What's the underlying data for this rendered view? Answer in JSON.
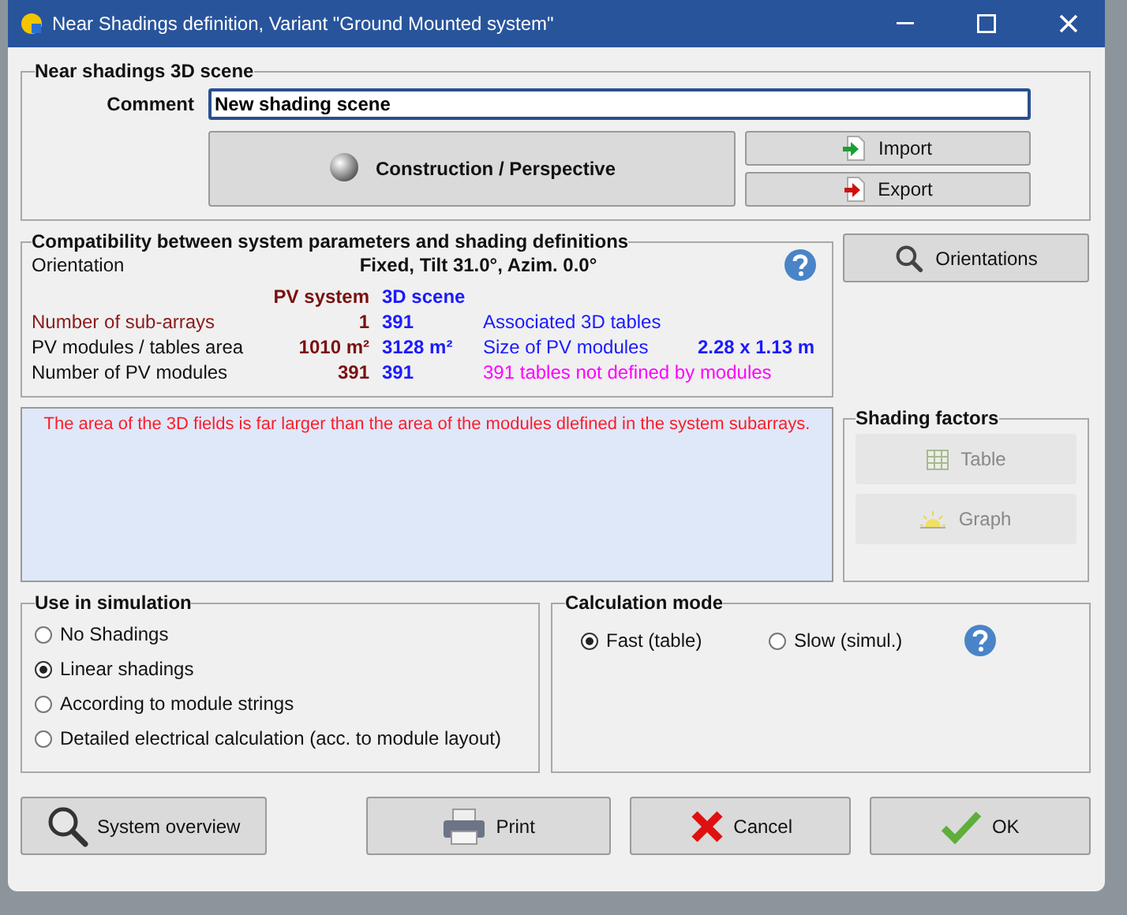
{
  "window": {
    "title": "Near Shadings definition, Variant \"Ground Mounted system\""
  },
  "scene": {
    "title": "Near shadings 3D scene",
    "comment_label": "Comment",
    "comment_value": "New shading scene",
    "construction_button": "Construction / Perspective",
    "import_button": "Import",
    "export_button": "Export"
  },
  "compatibility": {
    "title": "Compatibility between system parameters and shading definitions",
    "orientation_label": "Orientation",
    "orientation_value": "Fixed, Tilt 31.0°, Azim. 0.0°",
    "col_pv": "PV system",
    "col_scene": "3D scene",
    "rows": [
      {
        "label": {
          "text": "Number of sub-arrays",
          "color": "#8b1a1a"
        },
        "pv": "1",
        "scene": "391",
        "note": {
          "text": "Associated 3D tables",
          "color": "#1a1aff"
        }
      },
      {
        "label": {
          "text": "PV modules / tables area",
          "color": "#111111"
        },
        "pv": "1010 m²",
        "scene": "3128 m²",
        "note": {
          "text": "Size of PV modules",
          "color": "#1a1aff"
        },
        "value": "2.28 x 1.13 m"
      },
      {
        "label": {
          "text": "Number of PV modules",
          "color": "#111111"
        },
        "pv": "391",
        "scene": "391",
        "note": {
          "text": "391 tables not defined by modules",
          "color": "#ff00ff"
        }
      }
    ]
  },
  "orientations_button": "Orientations",
  "message": "The area of the 3D fields is far larger than the area of the modules dlefined in the system subarrays.",
  "shading_factors": {
    "title": "Shading factors",
    "buttons": [
      {
        "label": "Table",
        "kind": "table",
        "disabled": true
      },
      {
        "label": "Graph",
        "kind": "graph",
        "disabled": true
      }
    ]
  },
  "use_in_simulation": {
    "title": "Use in simulation",
    "options": [
      {
        "label": "No Shadings",
        "selected": false
      },
      {
        "label": "Linear shadings",
        "selected": true
      },
      {
        "label": "According to module strings",
        "selected": false
      },
      {
        "label": "Detailed electrical calculation (acc. to module layout)",
        "selected": false
      }
    ]
  },
  "calculation_mode": {
    "title": "Calculation mode",
    "options": [
      {
        "label": "Fast (table)",
        "selected": true
      },
      {
        "label": "Slow (simul.)",
        "selected": false
      }
    ]
  },
  "buttons": [
    {
      "label": "System overview",
      "kind": "overview"
    },
    {
      "label": "Print",
      "kind": "print"
    },
    {
      "label": "Cancel",
      "kind": "cancel"
    },
    {
      "label": "OK",
      "kind": "ok"
    }
  ]
}
